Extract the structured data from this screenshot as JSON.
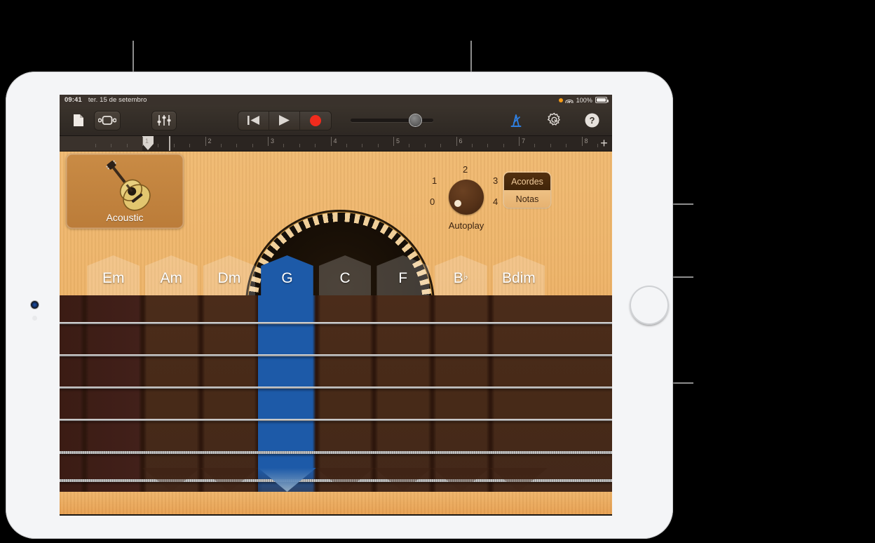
{
  "status_bar": {
    "time": "09:41",
    "date": "ter. 15 de setembro",
    "battery_percent": "100%",
    "icons": [
      "orange-recording-dot",
      "wifi-icon",
      "battery-icon"
    ]
  },
  "toolbar": {
    "navigation_icon": "document-icon",
    "loops_icon": "track-view-icon",
    "mixer_icon": "mixer-sliders-icon",
    "rewind_label": "rewind-icon",
    "play_label": "play-icon",
    "record_label": "record-icon",
    "volume_slider_value": 72,
    "metronome_icon": "metronome-icon",
    "settings_icon": "gear-icon",
    "help_icon": "help-icon"
  },
  "ruler": {
    "bars": [
      "1",
      "2",
      "3",
      "4",
      "5",
      "6",
      "7",
      "8"
    ],
    "playhead_bar": "1",
    "add_label": "+"
  },
  "instrument": {
    "name": "Acoustic",
    "icon": "acoustic-guitar-icon"
  },
  "autoplay": {
    "caption": "Autoplay",
    "positions": [
      "0",
      "1",
      "2",
      "3",
      "4"
    ],
    "selected": "0"
  },
  "mode_switch": {
    "options": [
      {
        "label": "Acordes",
        "selected": true
      },
      {
        "label": "Notas",
        "selected": false
      }
    ]
  },
  "chords": [
    {
      "name": "Em",
      "accidental": "",
      "active": false
    },
    {
      "name": "Am",
      "accidental": "",
      "active": false
    },
    {
      "name": "Dm",
      "accidental": "",
      "active": false
    },
    {
      "name": "G",
      "accidental": "",
      "active": true
    },
    {
      "name": "C",
      "accidental": "",
      "active": false
    },
    {
      "name": "F",
      "accidental": "",
      "active": false
    },
    {
      "name": "B",
      "accidental": "♭",
      "active": false
    },
    {
      "name": "Bdim",
      "accidental": "",
      "active": false
    }
  ],
  "fretboard": {
    "string_count": 6,
    "active_chord": "G"
  },
  "colors": {
    "accent_blue": "#1d5aa8",
    "wood_light": "#eeb469",
    "wood_dark": "#472a18",
    "record_red": "#f02b1d",
    "metronome_blue": "#2f7fe0"
  }
}
